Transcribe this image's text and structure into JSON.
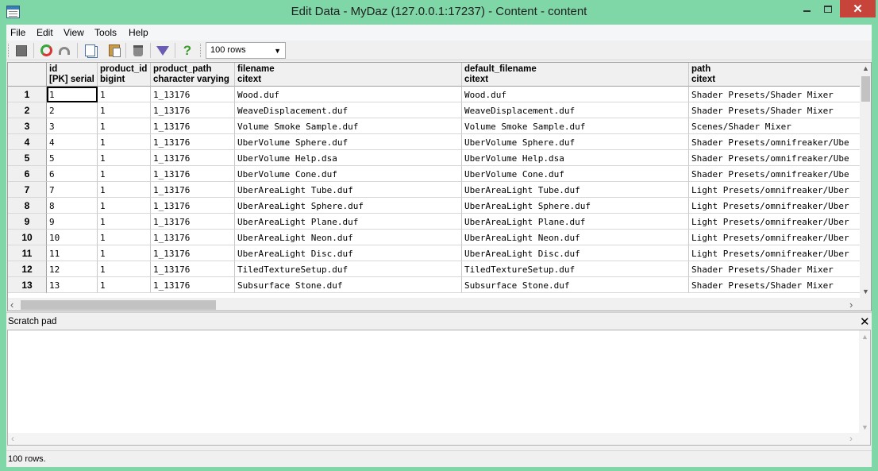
{
  "window": {
    "title": "Edit Data - MyDaz (127.0.0.1:17237) - Content - content"
  },
  "menu": [
    "File",
    "Edit",
    "View",
    "Tools",
    "Help"
  ],
  "toolbar": {
    "icons": [
      "stop-icon",
      "refresh-icon",
      "undo-icon",
      "copy-icon",
      "paste-icon",
      "delete-row-icon",
      "filter-icon",
      "help-icon"
    ],
    "rows_limit": "100 rows"
  },
  "grid": {
    "columns": [
      {
        "name": "id",
        "type": "[PK] serial"
      },
      {
        "name": "product_id",
        "type": "bigint"
      },
      {
        "name": "product_path",
        "type": "character varying"
      },
      {
        "name": "filename",
        "type": "citext"
      },
      {
        "name": "default_filename",
        "type": "citext"
      },
      {
        "name": "path",
        "type": "citext"
      }
    ],
    "rows": [
      {
        "n": "1",
        "cells": [
          "1",
          "1",
          "1_13176",
          "Wood.duf",
          "Wood.duf",
          "Shader Presets/Shader Mixer"
        ]
      },
      {
        "n": "2",
        "cells": [
          "2",
          "1",
          "1_13176",
          "WeaveDisplacement.duf",
          "WeaveDisplacement.duf",
          "Shader Presets/Shader Mixer"
        ]
      },
      {
        "n": "3",
        "cells": [
          "3",
          "1",
          "1_13176",
          "Volume Smoke Sample.duf",
          "Volume Smoke Sample.duf",
          "Scenes/Shader Mixer"
        ]
      },
      {
        "n": "4",
        "cells": [
          "4",
          "1",
          "1_13176",
          "UberVolume Sphere.duf",
          "UberVolume Sphere.duf",
          "Shader Presets/omnifreaker/Ube"
        ]
      },
      {
        "n": "5",
        "cells": [
          "5",
          "1",
          "1_13176",
          "UberVolume Help.dsa",
          "UberVolume Help.dsa",
          "Shader Presets/omnifreaker/Ube"
        ]
      },
      {
        "n": "6",
        "cells": [
          "6",
          "1",
          "1_13176",
          "UberVolume Cone.duf",
          "UberVolume Cone.duf",
          "Shader Presets/omnifreaker/Ube"
        ]
      },
      {
        "n": "7",
        "cells": [
          "7",
          "1",
          "1_13176",
          "UberAreaLight Tube.duf",
          "UberAreaLight Tube.duf",
          "Light Presets/omnifreaker/Uber"
        ]
      },
      {
        "n": "8",
        "cells": [
          "8",
          "1",
          "1_13176",
          "UberAreaLight Sphere.duf",
          "UberAreaLight Sphere.duf",
          "Light Presets/omnifreaker/Uber"
        ]
      },
      {
        "n": "9",
        "cells": [
          "9",
          "1",
          "1_13176",
          "UberAreaLight Plane.duf",
          "UberAreaLight Plane.duf",
          "Light Presets/omnifreaker/Uber"
        ]
      },
      {
        "n": "10",
        "cells": [
          "10",
          "1",
          "1_13176",
          "UberAreaLight Neon.duf",
          "UberAreaLight Neon.duf",
          "Light Presets/omnifreaker/Uber"
        ]
      },
      {
        "n": "11",
        "cells": [
          "11",
          "1",
          "1_13176",
          "UberAreaLight Disc.duf",
          "UberAreaLight Disc.duf",
          "Light Presets/omnifreaker/Uber"
        ]
      },
      {
        "n": "12",
        "cells": [
          "12",
          "1",
          "1_13176",
          "TiledTextureSetup.duf",
          "TiledTextureSetup.duf",
          "Shader Presets/Shader Mixer"
        ]
      },
      {
        "n": "13",
        "cells": [
          "13",
          "1",
          "1_13176",
          "Subsurface Stone.duf",
          "Subsurface Stone.duf",
          "Shader Presets/Shader Mixer"
        ]
      }
    ]
  },
  "scratch_pad": {
    "title": "Scratch pad"
  },
  "status": {
    "text": "100 rows."
  }
}
